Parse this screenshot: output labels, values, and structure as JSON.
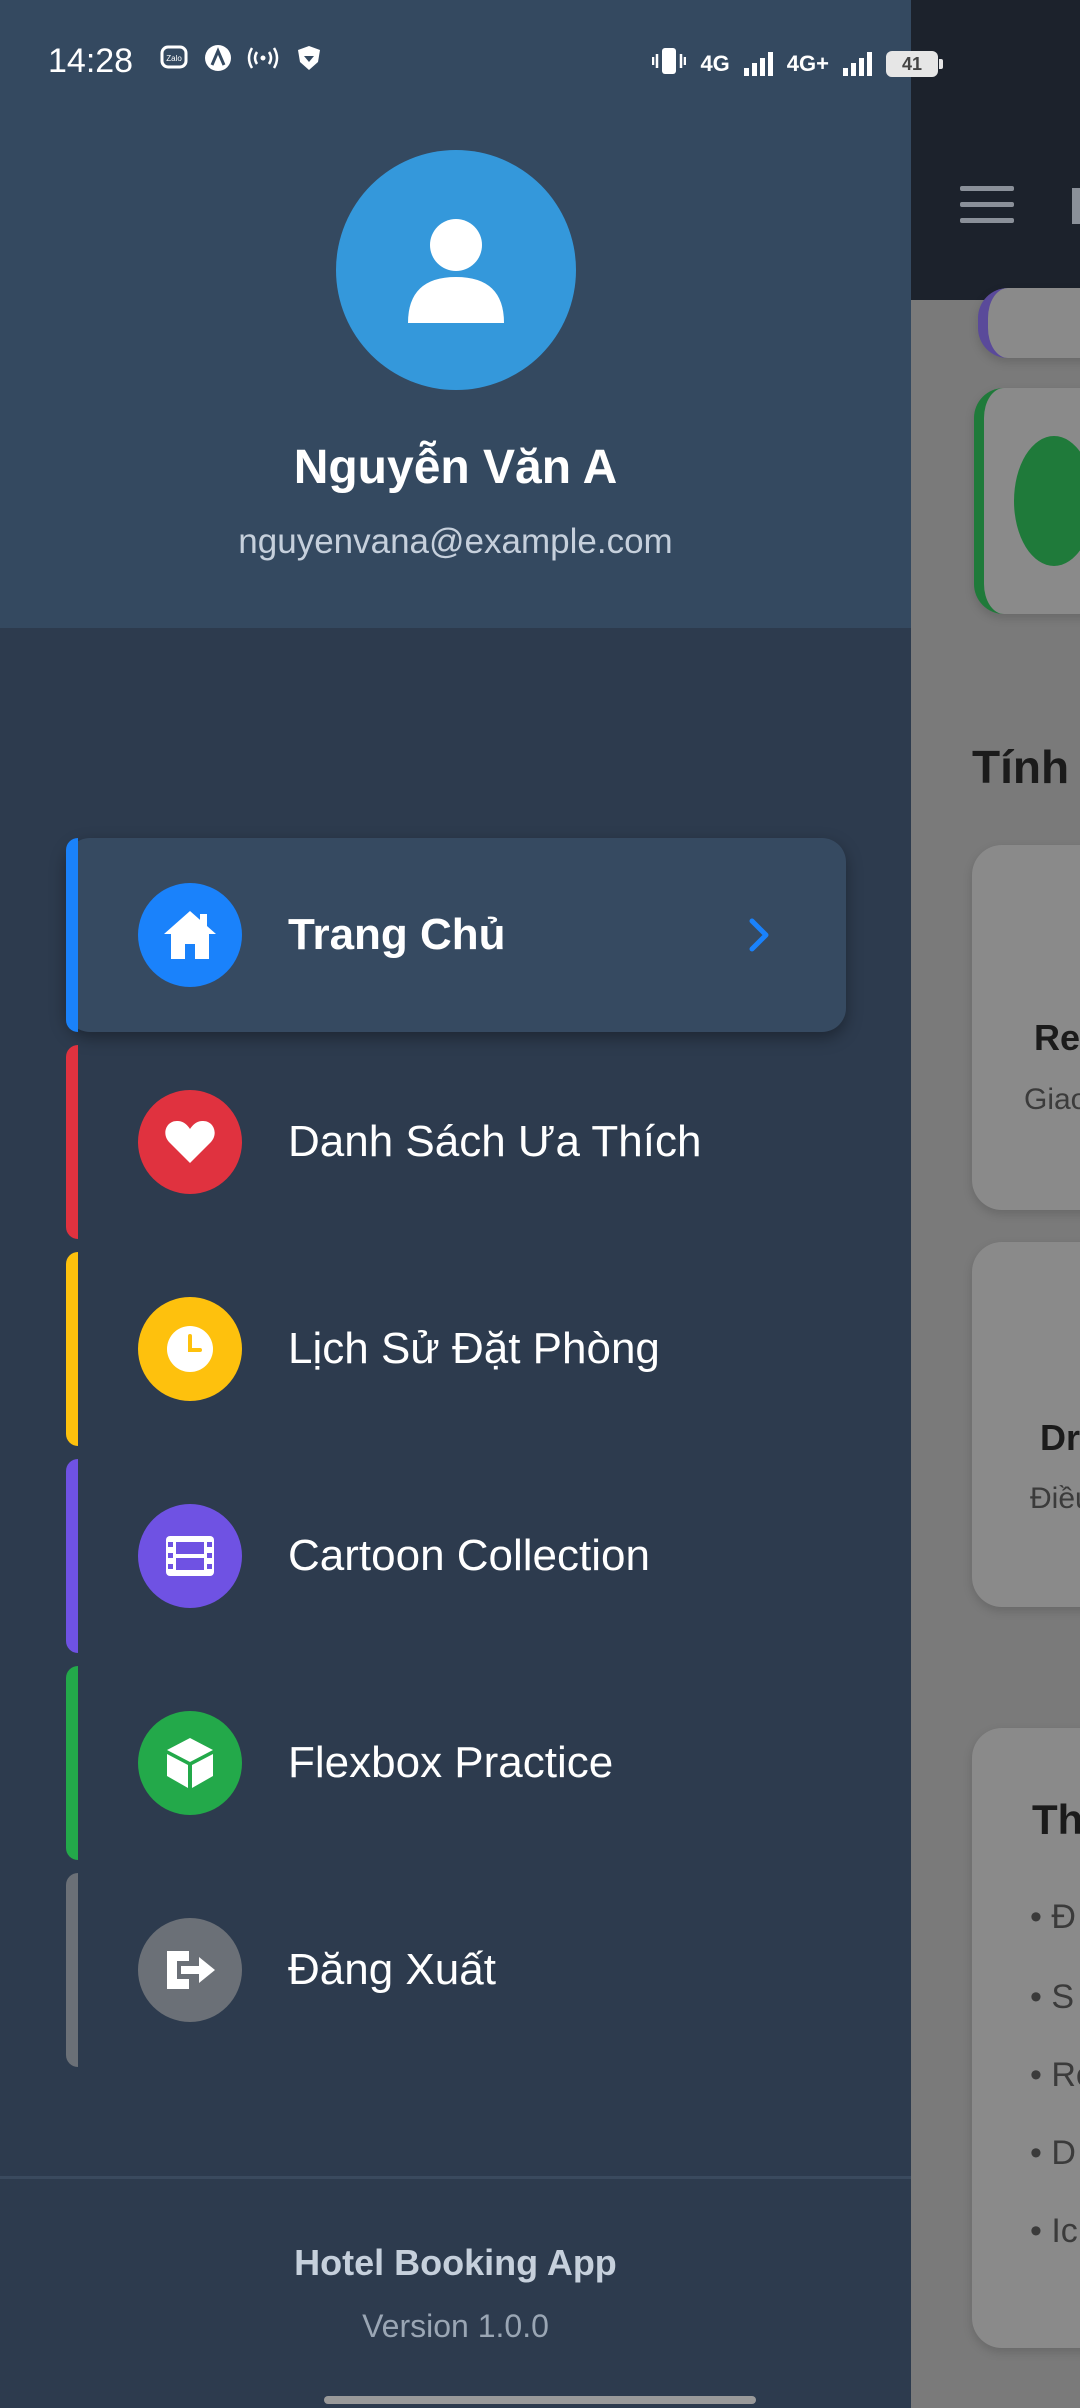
{
  "status_bar": {
    "time": "14:28",
    "notif_icons": [
      "zalo-icon",
      "a-icon",
      "hotspot-icon",
      "shield-icon"
    ],
    "network_1": "4G",
    "network_2": "4G+",
    "battery": "41"
  },
  "drawer": {
    "user": {
      "name": "Nguyễn Văn A",
      "email": "nguyenvana@example.com"
    },
    "items": [
      {
        "label": "Trang Chủ",
        "icon": "home-icon",
        "color": "#1a82fb",
        "active": true
      },
      {
        "label": "Danh Sách Ưa Thích",
        "icon": "heart-icon",
        "color": "#e0323f",
        "active": false
      },
      {
        "label": "Lịch Sử Đặt Phòng",
        "icon": "clock-icon",
        "color": "#fec10d",
        "active": false
      },
      {
        "label": "Cartoon Collection",
        "icon": "film-icon",
        "color": "#6f52e3",
        "active": false
      },
      {
        "label": "Flexbox Practice",
        "icon": "cube-icon",
        "color": "#23a94a",
        "active": false
      },
      {
        "label": "Đăng Xuất",
        "icon": "logout-icon",
        "color": "#6b7077",
        "active": false
      }
    ],
    "footer": {
      "app_name": "Hotel Booking App",
      "version": "Version 1.0.0"
    }
  },
  "background": {
    "section_title": "Tính",
    "cards": [
      {
        "title": "Re",
        "subtitle": "Giao"
      },
      {
        "title": "Dr",
        "subtitle": "Điều"
      }
    ],
    "list_title": "Th",
    "list_items": [
      "• Đ",
      "• S",
      "• Re",
      "• D",
      "• Ic"
    ]
  }
}
